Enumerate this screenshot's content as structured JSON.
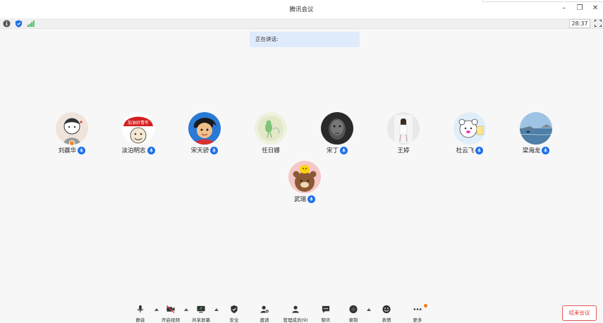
{
  "window": {
    "title": "腾讯会议"
  },
  "statusbar": {
    "timer": "28:37"
  },
  "speaking": {
    "label": "正在讲话:"
  },
  "participants": [
    {
      "name": "刘晨华",
      "mic": true,
      "host": true,
      "avatar": "cartoon-child"
    },
    {
      "name": "淡泊明志",
      "mic": true,
      "host": false,
      "avatar": "red-cap"
    },
    {
      "name": "宋天骄",
      "mic": true,
      "host": false,
      "avatar": "anime-boy"
    },
    {
      "name": "任日娜",
      "mic": false,
      "host": false,
      "avatar": "green-bird"
    },
    {
      "name": "宋丁",
      "mic": true,
      "host": false,
      "avatar": "dark-face"
    },
    {
      "name": "王婷",
      "mic": false,
      "host": false,
      "avatar": "girl-photo"
    },
    {
      "name": "杜云飞",
      "mic": true,
      "host": false,
      "avatar": "cartoon-bear"
    },
    {
      "name": "梁海龙",
      "mic": true,
      "host": false,
      "avatar": "seaside"
    },
    {
      "name": "武瑞",
      "mic": true,
      "host": false,
      "avatar": "brown-bear-chick"
    }
  ],
  "toolbar": {
    "mute": "静音",
    "video": "开启视频",
    "share": "共享屏幕",
    "security": "安全",
    "invite": "邀请",
    "members": "管理成员(9)",
    "chat": "聊天",
    "record": "录制",
    "reactions": "表情",
    "more": "更多",
    "end": "结束会议"
  },
  "colors": {
    "accent": "#1f6fe8",
    "end_red": "#e03c3c",
    "banner": "#dfeafb"
  }
}
